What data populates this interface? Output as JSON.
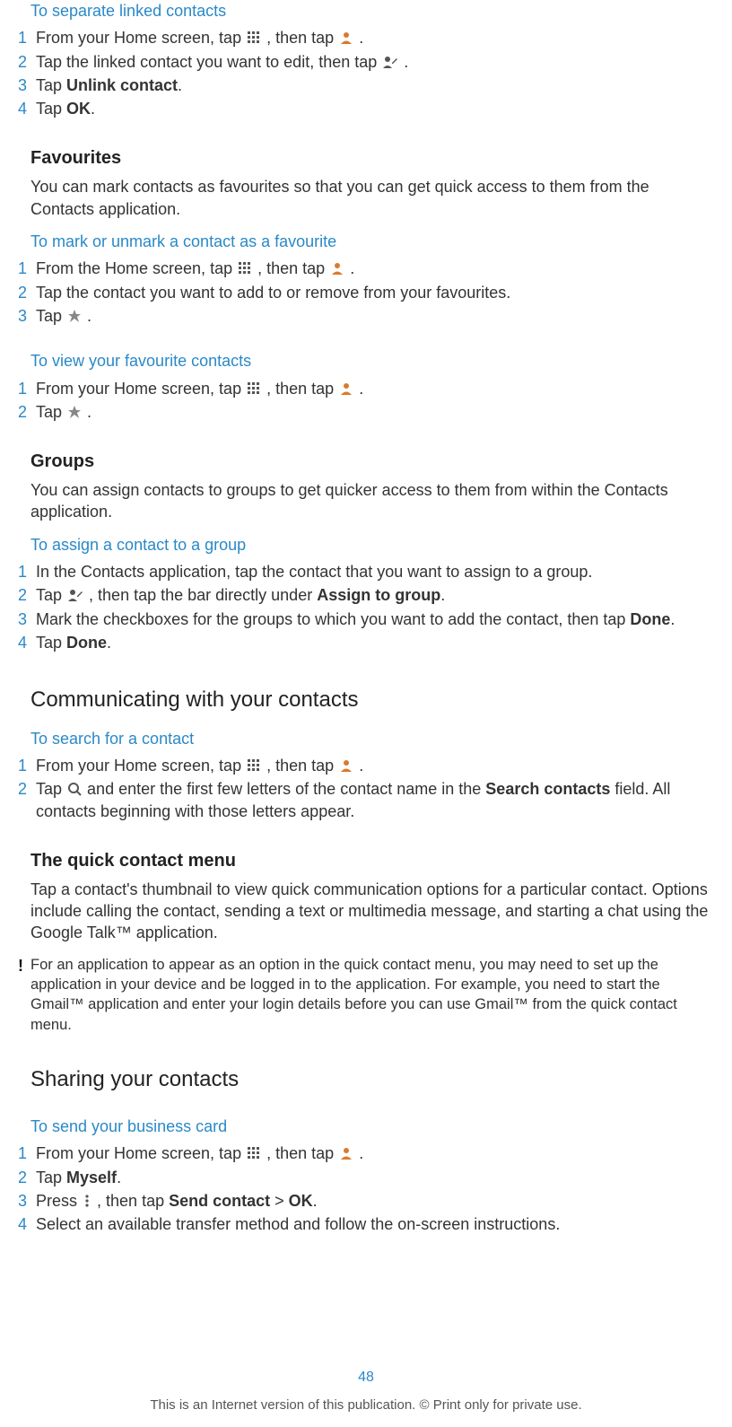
{
  "sec_separate": {
    "title": "To separate linked contacts",
    "s1a": "From your Home screen, tap ",
    "s1b": ", then tap ",
    "s1c": ".",
    "s2a": "Tap the linked contact you want to edit, then tap ",
    "s2b": ".",
    "s3a": "Tap ",
    "s3b": "Unlink contact",
    "s3c": ".",
    "s4a": "Tap ",
    "s4b": "OK",
    "s4c": "."
  },
  "sec_fav": {
    "heading": "Favourites",
    "para": "You can mark contacts as favourites so that you can get quick access to them from the Contacts application.",
    "mark_title": "To mark or unmark a contact as a favourite",
    "m1a": "From the Home screen, tap ",
    "m1b": ", then tap ",
    "m1c": ".",
    "m2": "Tap the contact you want to add to or remove from your favourites.",
    "m3a": "Tap ",
    "m3b": ".",
    "view_title": "To view your favourite contacts",
    "v1a": "From your Home screen, tap ",
    "v1b": ", then tap ",
    "v1c": ".",
    "v2a": "Tap ",
    "v2b": "."
  },
  "sec_groups": {
    "heading": "Groups",
    "para": "You can assign contacts to groups to get quicker access to them from within the Contacts application.",
    "assign_title": "To assign a contact to a group",
    "a1": "In the Contacts application, tap the contact that you want to assign to a group.",
    "a2a": "Tap ",
    "a2b": ", then tap the bar directly under ",
    "a2c": "Assign to group",
    "a2d": ".",
    "a3a": "Mark the checkboxes for the groups to which you want to add the contact, then tap ",
    "a3b": "Done",
    "a3c": ".",
    "a4a": "Tap ",
    "a4b": "Done",
    "a4c": "."
  },
  "sec_comm": {
    "heading": "Communicating with your contacts",
    "search_title": "To search for a contact",
    "s1a": "From your Home screen, tap ",
    "s1b": ", then tap ",
    "s1c": ".",
    "s2a": "Tap ",
    "s2b": " and enter the first few letters of the contact name in the ",
    "s2c": "Search contacts",
    "s2d": " field. All contacts beginning with those letters appear.",
    "quick_heading": "The quick contact menu",
    "quick_para": "Tap a contact's thumbnail to view quick communication options for a particular contact. Options include calling the contact, sending a text or multimedia message, and starting a chat using the Google Talk™ application.",
    "note": "For an application to appear as an option in the quick contact menu, you may need to set up the application in your device and be logged in to the application. For example, you need to start the Gmail™ application and enter your login details before you can use Gmail™ from the quick contact menu."
  },
  "sec_share": {
    "heading": "Sharing your contacts",
    "biz_title": "To send your business card",
    "b1a": "From your Home screen, tap ",
    "b1b": ", then tap ",
    "b1c": ".",
    "b2a": "Tap ",
    "b2b": "Myself",
    "b2c": ".",
    "b3a": "Press ",
    "b3b": ", then tap ",
    "b3c": "Send contact",
    "b3d": " > ",
    "b3e": "OK",
    "b3f": ".",
    "b4": "Select an available transfer method and follow the on-screen instructions."
  },
  "nums": {
    "n1": "1",
    "n2": "2",
    "n3": "3",
    "n4": "4"
  },
  "page_number": "48",
  "footer": "This is an Internet version of this publication. © Print only for private use."
}
